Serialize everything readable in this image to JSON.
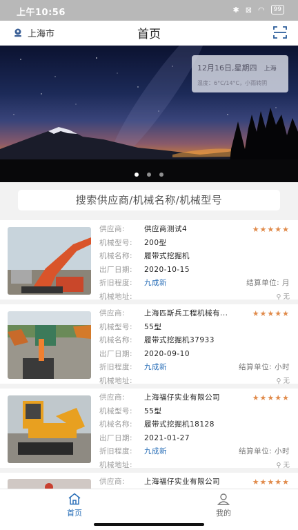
{
  "status_bar": {
    "time": "上午10:56",
    "battery": "99"
  },
  "header": {
    "location": "上海市",
    "title": "首页"
  },
  "banner": {
    "weather": {
      "date": "12月16日,星期四",
      "city": "上海",
      "temperature": "温度：6°C/14°C，小雨转阴"
    },
    "slide_count": 3,
    "active_slide": 0
  },
  "search": {
    "placeholder": "搜索供应商/机械名称/机械型号"
  },
  "labels": {
    "supplier": "供应商:",
    "model": "机械型号:",
    "name": "机械名称:",
    "date": "出厂日期:",
    "condition": "折旧程度:",
    "address": "机械地址:",
    "settlement": "结算单位:",
    "address_empty": "无"
  },
  "listings": [
    {
      "supplier": "供应商测试4",
      "model": "200型",
      "name": "履带式挖掘机",
      "date": "2020-10-15",
      "condition": "九成新",
      "unit": "月",
      "rating": "★★★★★"
    },
    {
      "supplier": "上海匹斯兵工程机械有...",
      "model": "55型",
      "name": "履带式挖掘机37933",
      "date": "2020-09-10",
      "condition": "九成新",
      "unit": "小时",
      "rating": "★★★★★"
    },
    {
      "supplier": "上海福仔实业有限公司",
      "model": "55型",
      "name": "履带式挖掘机18128",
      "date": "2021-01-27",
      "condition": "九成新",
      "unit": "小时",
      "rating": "★★★★★"
    },
    {
      "supplier": "上海福仔实业有限公司",
      "rating": "★★★★★"
    }
  ],
  "tabs": [
    {
      "label": "首页",
      "active": true
    },
    {
      "label": "我的",
      "active": false
    }
  ],
  "colors": {
    "accent": "#2a6fb8",
    "star": "#e08a4a"
  }
}
